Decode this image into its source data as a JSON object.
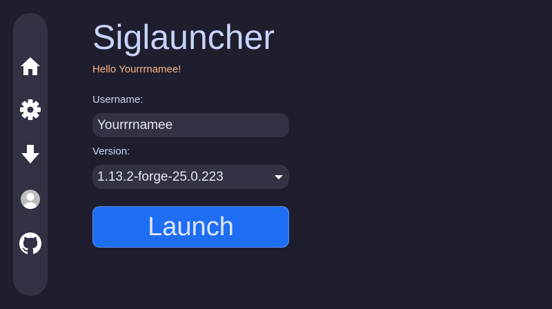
{
  "app": {
    "title": "Siglauncher",
    "greeting": "Hello Yourrrnamee!"
  },
  "sidebar": {
    "items": [
      {
        "id": "home",
        "icon": "home-icon"
      },
      {
        "id": "settings",
        "icon": "gear-icon"
      },
      {
        "id": "downloads",
        "icon": "download-arrow-icon"
      },
      {
        "id": "account",
        "icon": "user-avatar-icon"
      },
      {
        "id": "github",
        "icon": "github-icon"
      }
    ]
  },
  "form": {
    "username_label": "Username:",
    "username_value": "Yourrrnamee",
    "version_label": "Version:",
    "version_value": "1.13.2-forge-25.0.223",
    "launch_label": "Launch"
  },
  "colors": {
    "background": "#1e1e2e",
    "surface": "#313244",
    "title": "#c9d2fb",
    "greeting": "#fab387",
    "accent": "#1e6ef4"
  }
}
